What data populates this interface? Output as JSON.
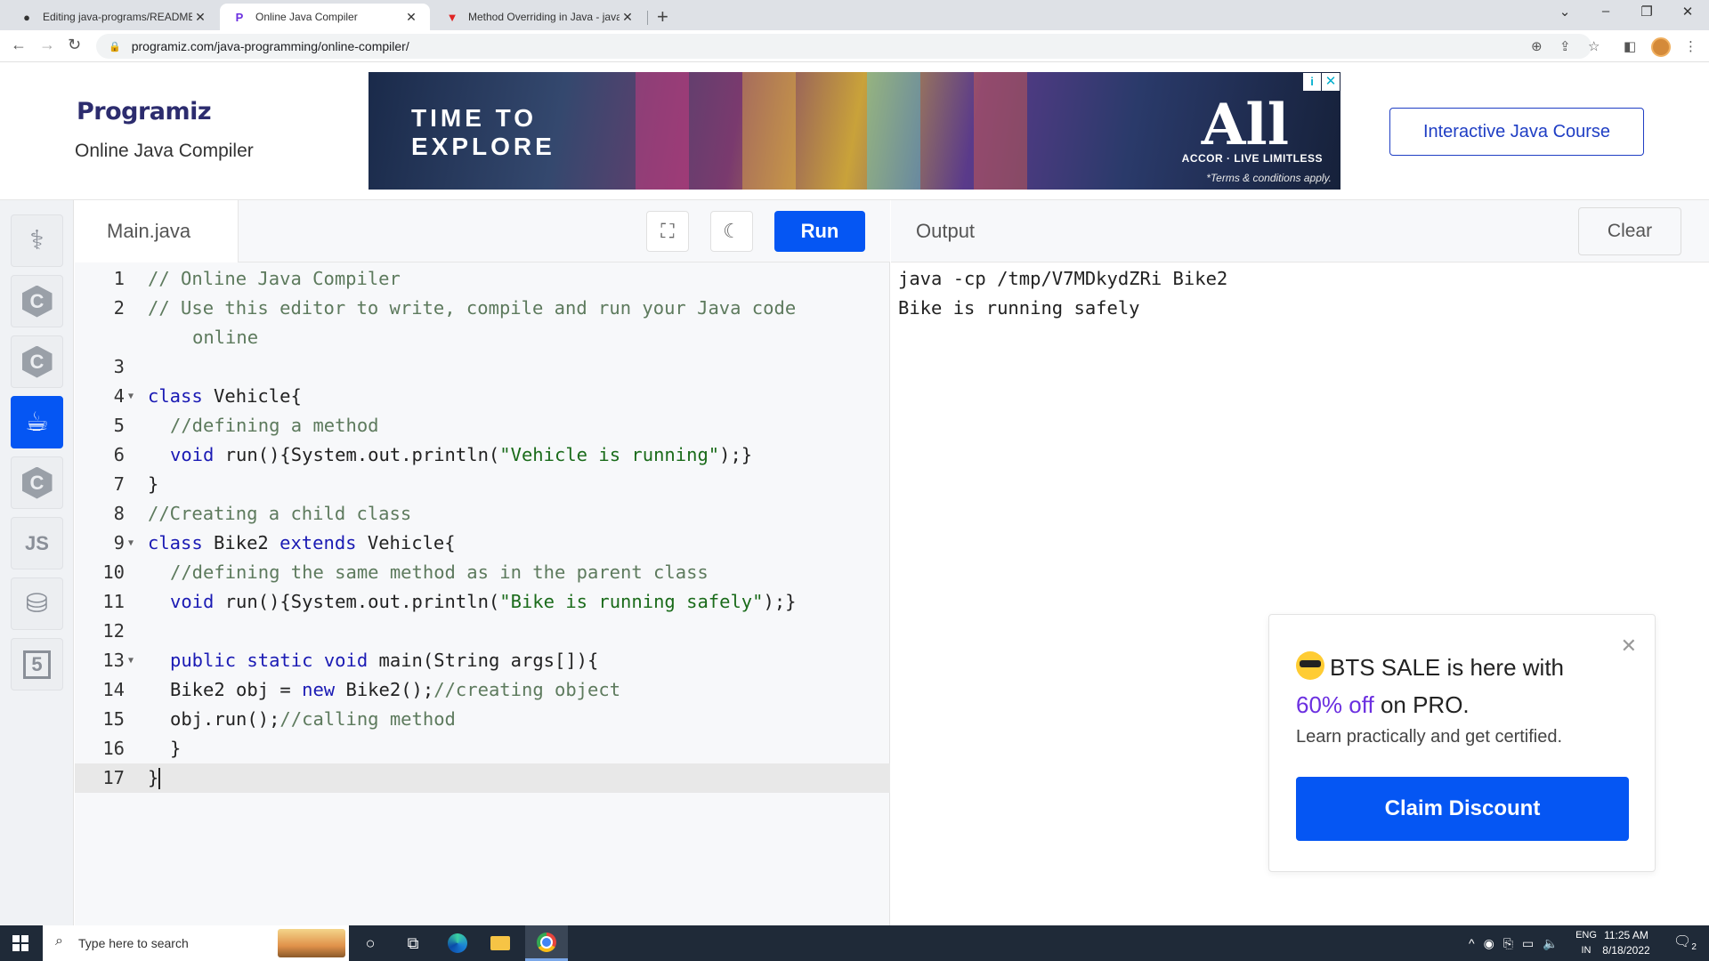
{
  "browser": {
    "tabs": [
      {
        "title": "Editing java-programs/README.md",
        "favicon": "github-icon"
      },
      {
        "title": "Online Java Compiler",
        "favicon": "programiz-icon"
      },
      {
        "title": "Method Overriding in Java - javatpoint",
        "favicon": "javatpoint-icon"
      }
    ],
    "url": "programiz.com/java-programming/online-compiler/"
  },
  "header": {
    "logo": "Programiz",
    "subtitle": "Online Java Compiler",
    "ad": {
      "title_line1": "TIME TO",
      "title_line2": "EXPLORE",
      "brand": "All",
      "tagline": "ACCOR · LIVE LIMITLESS",
      "terms": "*Terms & conditions apply."
    },
    "course_button": "Interactive Java Course"
  },
  "sidebar": {
    "items": [
      {
        "name": "python",
        "label": ""
      },
      {
        "name": "c",
        "label": "C"
      },
      {
        "name": "cpp",
        "label": "C"
      },
      {
        "name": "java",
        "label": ""
      },
      {
        "name": "csharp",
        "label": "C"
      },
      {
        "name": "javascript",
        "label": "JS"
      },
      {
        "name": "sql",
        "label": ""
      },
      {
        "name": "html",
        "label": "5"
      }
    ]
  },
  "editor": {
    "filename": "Main.java",
    "run_label": "Run",
    "lines": [
      {
        "n": "1",
        "text": "// Online Java Compiler"
      },
      {
        "n": "2",
        "text": "// Use this editor to write, compile and run your Java code"
      },
      {
        "n": "",
        "text": "online"
      },
      {
        "n": "3",
        "text": ""
      },
      {
        "n": "4",
        "text": "class Vehicle{"
      },
      {
        "n": "5",
        "text": "//defining a method"
      },
      {
        "n": "6",
        "text": "void run(){System.out.println(\"Vehicle is running\");}"
      },
      {
        "n": "7",
        "text": "}"
      },
      {
        "n": "8",
        "text": "//Creating a child class"
      },
      {
        "n": "9",
        "text": "class Bike2 extends Vehicle{"
      },
      {
        "n": "10",
        "text": "//defining the same method as in the parent class"
      },
      {
        "n": "11",
        "text": "void run(){System.out.println(\"Bike is running safely\");}"
      },
      {
        "n": "12",
        "text": ""
      },
      {
        "n": "13",
        "text": "public static void main(String args[]){"
      },
      {
        "n": "14",
        "text": "Bike2 obj = new Bike2();//creating object"
      },
      {
        "n": "15",
        "text": "obj.run();//calling method"
      },
      {
        "n": "16",
        "text": "}"
      },
      {
        "n": "17",
        "text": "}"
      }
    ]
  },
  "output": {
    "title": "Output",
    "clear_label": "Clear",
    "lines": [
      "java -cp /tmp/V7MDkydZRi Bike2",
      "Bike is running safely"
    ]
  },
  "promo": {
    "headline_start": "BTS SALE is here with",
    "highlight": "60% off",
    "headline_end": "on PRO.",
    "sub": "Learn practically and get certified.",
    "button": "Claim Discount"
  },
  "taskbar": {
    "search_placeholder": "Type here to search",
    "lang_line1": "ENG",
    "lang_line2": "IN",
    "time": "11:25 AM",
    "date": "8/18/2022",
    "notifications": "2"
  },
  "colors": {
    "accent": "#0556f3",
    "brand_purple": "#6b2fe0",
    "course_border": "#1f3ec4"
  }
}
